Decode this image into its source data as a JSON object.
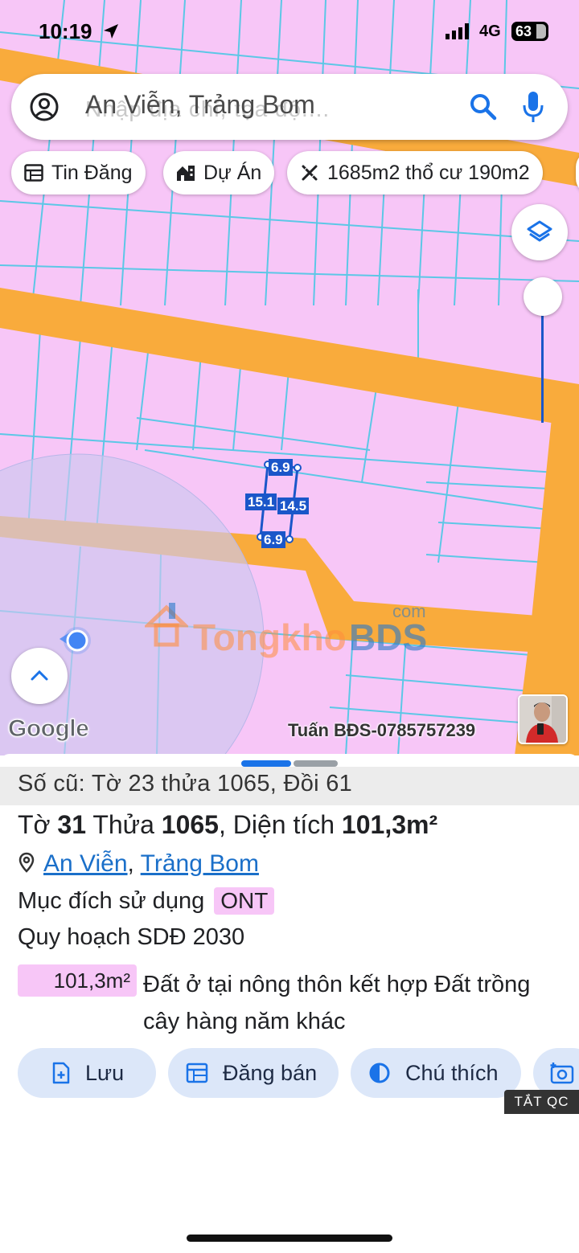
{
  "status_bar": {
    "time": "10:19",
    "network": "4G",
    "battery": "63"
  },
  "search": {
    "value": "An Viễn, Trảng Bom",
    "ghost_hint": "Nhập địa chỉ, tọa độ...."
  },
  "chips": [
    {
      "label": "Tin Đăng",
      "icon": "listing-icon"
    },
    {
      "label": "Dự Án",
      "icon": "building-icon"
    },
    {
      "label": "1685m2 thổ cư 190m2",
      "icon": "ruler-cross-icon"
    }
  ],
  "map": {
    "land_color": "#f7c6f7",
    "road_color": "#f9ab3c",
    "parcel_line_color": "#5cc7e6",
    "highlight_color": "#1a56c9",
    "measurements": {
      "top": "6.9",
      "left": "15.1",
      "right": "14.5",
      "bottom": "6.9"
    },
    "watermark": {
      "part1": "Tongkho",
      "part2": "BDS",
      "suffix": "com"
    },
    "google_logo": "Google",
    "credit": "Tuấn BĐS-0785757239"
  },
  "sheet": {
    "old_record": "Số cũ: Tờ 23 thửa 1065, Đồi 61",
    "title": {
      "sheet_label": "Tờ",
      "sheet_no": "31",
      "parcel_label": "Thửa",
      "parcel_no": "1065",
      "area_label": "Diện tích",
      "area": "101,3m²"
    },
    "location": {
      "commune": "An Viễn",
      "separator": ",",
      "district": "Trảng Bom"
    },
    "purpose": {
      "label": "Mục đích sử dụng",
      "code": "ONT"
    },
    "planning_label": "Quy hoạch SDĐ 2030",
    "planning_area": "101,3m²",
    "planning_desc": "Đất ở tại nông thôn kết hợp Đất trồng cây hàng năm khác",
    "actions": [
      {
        "label": "Lưu",
        "icon": "save-icon"
      },
      {
        "label": "Đăng bán",
        "icon": "post-sale-icon"
      },
      {
        "label": "Chú thích",
        "icon": "legend-icon"
      }
    ],
    "ad_toggle": "TẮT QC"
  }
}
